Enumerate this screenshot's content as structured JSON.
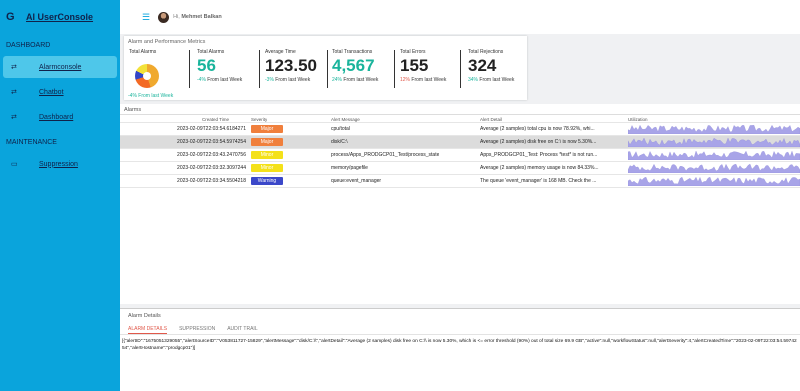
{
  "app": {
    "title": "AI UserConsole",
    "user_greeting": "Hi, ",
    "user_name": "Mehmet Balkan"
  },
  "sidebar": {
    "sections": [
      {
        "heading": "DASHBOARD",
        "items": [
          {
            "label": "Alarmconsole",
            "icon": "swap-icon",
            "active": true
          },
          {
            "label": "Chatbot",
            "icon": "swap-icon",
            "active": false
          },
          {
            "label": "Dashboard",
            "icon": "swap-icon",
            "active": false
          }
        ]
      },
      {
        "heading": "MAINTENANCE",
        "items": [
          {
            "label": "Suppression",
            "icon": "suppression-icon",
            "active": false
          }
        ]
      }
    ]
  },
  "metrics": {
    "title": "Alarm and Performance Metrics",
    "total_alarms_pie_label": "Total Alarms",
    "pie_footer": "-4% From last Week",
    "cards": [
      {
        "label": "Total Alarms",
        "value": "56",
        "change": "-4%",
        "suffix": "From last Week",
        "positive": true
      },
      {
        "label": "Average Time",
        "value": "123.50",
        "change": "-3%",
        "suffix": "From last Week",
        "positive": true
      },
      {
        "label": "Total Transactions",
        "value": "4,567",
        "change": "24%",
        "suffix": "From last Week",
        "positive": true
      },
      {
        "label": "Total Errors",
        "value": "155",
        "change": "12%",
        "suffix": "From last Week",
        "positive": false
      },
      {
        "label": "Total Rejections",
        "value": "324",
        "change": "34%",
        "suffix": "From last Week",
        "positive": true
      }
    ]
  },
  "alarms": {
    "title": "Alarms",
    "columns": [
      "Created Time",
      "Severity",
      "Alert Message",
      "Alert Detail",
      "Utilization"
    ],
    "rows": [
      {
        "time": "2023-02-09T22:03:54.6184271",
        "severity": "Major",
        "color": "#f07f3c",
        "message": "cpu/total",
        "detail": "Average (2 samples) total cpu is now 78.92%, whi..."
      },
      {
        "time": "2023-02-09T22:03:54.5974254",
        "severity": "Major",
        "color": "#f07f3c",
        "message": "disk/C:\\",
        "detail": "Average (2 samples) disk free on C:\\ is now 5.30%..."
      },
      {
        "time": "2023-02-09T22:03:43.2470756",
        "severity": "Minor",
        "color": "#f4e11a",
        "message": "process/Apps_PRODGCP01_Test/process_state",
        "detail": "Apps_PRODGCP01_Test: Process *test* is not run..."
      },
      {
        "time": "2023-02-09T22:03:32.3097244",
        "severity": "Minor",
        "color": "#f4e11a",
        "message": "memory/pagefile",
        "detail": "Average (2 samples) memory usage is now 84.33%..."
      },
      {
        "time": "2023-02-09T22:03:34.5504218",
        "severity": "Warning",
        "color": "#3b48c9",
        "message": "queue:event_manager",
        "detail": "The queue 'event_manager' is 168 MB. Check the ..."
      }
    ]
  },
  "details": {
    "title": "Alarm Details",
    "tabs": [
      "ALARM DETAILS",
      "SUPPRESSION",
      "AUDIT TRAIL"
    ],
    "json": "[{\"alertID\":\"1675051329055\",\"alertSourceID\":\"V053811727-15829\",\"alertMessage\":\"disk/C:\\\\\",\"alertDetail\":\"Average (2 samples) disk free on C:\\\\ is now 5.30%, which is <= error threshold (90%) out of total size 69.9 GB\",\"active\":null,\"workflowStatus\":null,\"alertSeverity\":4,\"alertCreatedTime\":\"2023-02-09T22:03:54.5974254\",\"alertHostname\":\"prodgcp01\"}]"
  }
}
